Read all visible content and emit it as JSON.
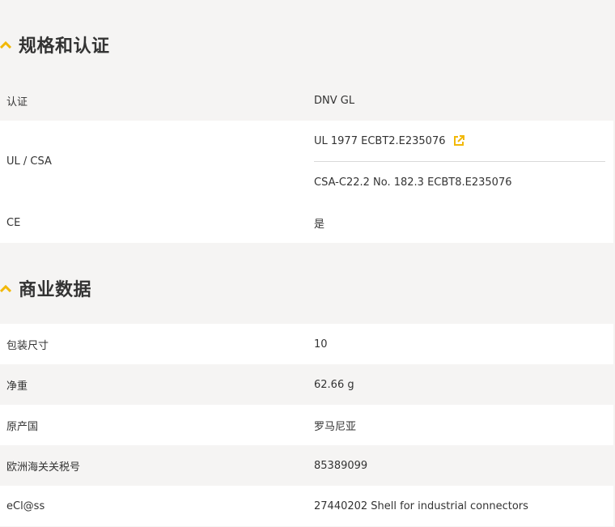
{
  "accent_color": "#f2b807",
  "sections": [
    {
      "title": "规格和认证",
      "rows": [
        {
          "key": "认证",
          "value": "DNV GL"
        },
        {
          "key": "UL / CSA",
          "values": [
            "UL 1977 ECBT2.E235076",
            "CSA-C22.2 No. 182.3 ECBT8.E235076"
          ]
        },
        {
          "key": "CE",
          "value": "是"
        }
      ]
    },
    {
      "title": "商业数据",
      "rows": [
        {
          "key": "包装尺寸",
          "value": "10"
        },
        {
          "key": "净重",
          "value": "62.66 g"
        },
        {
          "key": "原产国",
          "value": "罗马尼亚"
        },
        {
          "key": "欧洲海关关税号",
          "value": "85389099"
        },
        {
          "key": "eCl@ss",
          "value": "27440202 Shell for industrial connectors"
        }
      ]
    }
  ],
  "icons": {
    "collapse": "chevron-up-icon",
    "external": "external-link-icon"
  }
}
